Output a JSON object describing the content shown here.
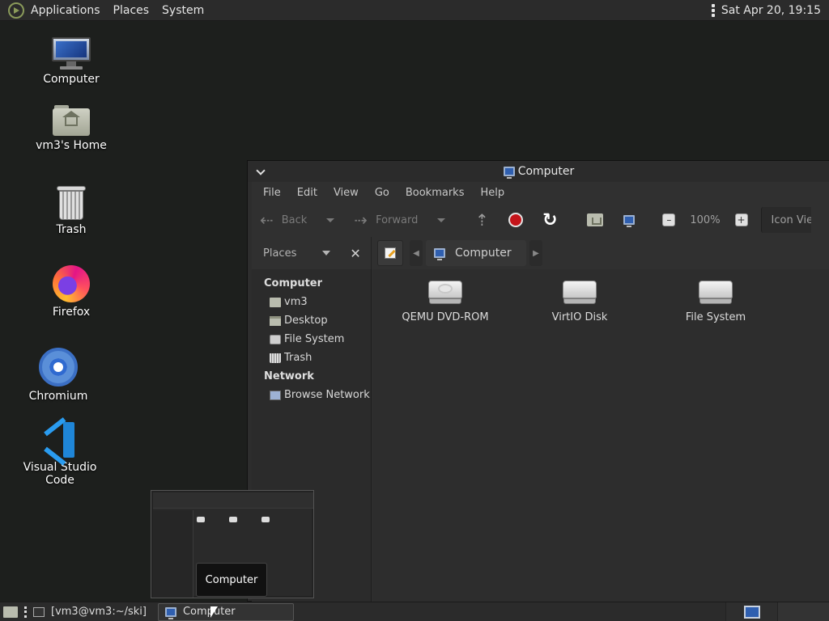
{
  "top_panel": {
    "menus": [
      "Applications",
      "Places",
      "System"
    ],
    "clock": "Sat Apr 20, 19:15"
  },
  "desktop": {
    "icons": [
      {
        "label": "Computer"
      },
      {
        "label": "vm3's Home"
      },
      {
        "label": "Trash"
      },
      {
        "label": "Firefox"
      },
      {
        "label": "Chromium"
      },
      {
        "label": "Visual Studio Code"
      }
    ]
  },
  "window": {
    "title": "Computer",
    "menubar": [
      "File",
      "Edit",
      "View",
      "Go",
      "Bookmarks",
      "Help"
    ],
    "toolbar": {
      "back_label": "Back",
      "forward_label": "Forward",
      "zoom_level": "100%",
      "view_mode": "Icon View"
    },
    "sidebar": {
      "header": "Places",
      "sections": [
        {
          "title": "Computer",
          "items": [
            "vm3",
            "Desktop",
            "File System",
            "Trash"
          ]
        },
        {
          "title": "Network",
          "items": [
            "Browse Network"
          ]
        }
      ]
    },
    "location": {
      "crumb": "Computer"
    },
    "drives": [
      {
        "label": "QEMU DVD-ROM",
        "icon": "optical-drive-icon"
      },
      {
        "label": "VirtIO Disk",
        "icon": "hard-disk-icon"
      },
      {
        "label": "File System",
        "icon": "hard-disk-icon"
      }
    ]
  },
  "preview": {
    "tooltip": "Computer"
  },
  "bottom_panel": {
    "tasks": [
      "[vm3@vm3:~/ski]",
      "Computer"
    ]
  },
  "colors": {
    "background": "#1d1f1d",
    "panel": "#2b2b2b",
    "stop_red": "#c4141a"
  }
}
